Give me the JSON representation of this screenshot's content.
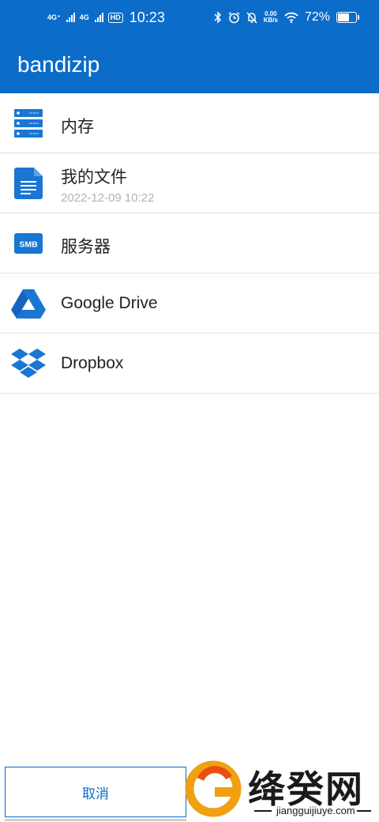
{
  "status_bar": {
    "net1": "4G⁺",
    "net2": "4G",
    "hd": "HD",
    "time": "10:23",
    "speed_value": "0.00",
    "speed_unit": "KB/s",
    "battery_pct": "72%",
    "battery_level": 0.72
  },
  "app_bar": {
    "title": "bandizip"
  },
  "list": {
    "items": [
      {
        "label": "内存",
        "sub": "",
        "icon": "server-icon"
      },
      {
        "label": "我的文件",
        "sub": "2022-12-09 10:22",
        "icon": "document-icon"
      },
      {
        "label": "服务器",
        "sub": "",
        "icon": "smb-icon",
        "icon_text": "SMB"
      },
      {
        "label": "Google Drive",
        "sub": "",
        "icon": "google-drive-icon"
      },
      {
        "label": "Dropbox",
        "sub": "",
        "icon": "dropbox-icon"
      }
    ]
  },
  "footer": {
    "cancel_label": "取消"
  },
  "watermark": {
    "title": "绛癸网",
    "url": "jiangguijiuye.com"
  },
  "colors": {
    "accent": "#0b6cc9",
    "icon_blue": "#1976d2",
    "divider": "#e2e2e2",
    "subtext": "#b3b3b3"
  }
}
